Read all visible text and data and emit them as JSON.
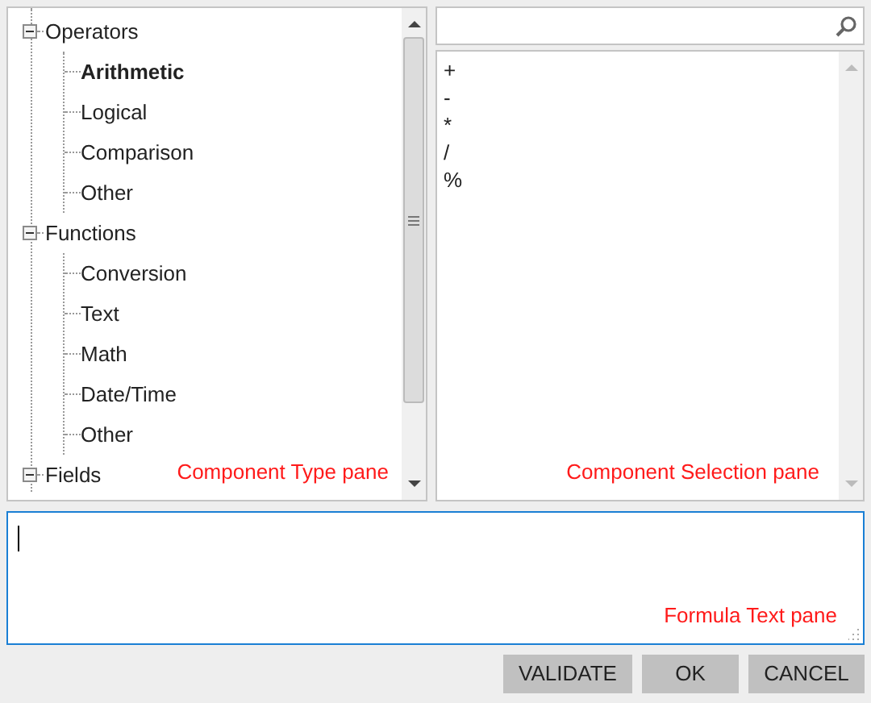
{
  "type_pane": {
    "tree": [
      {
        "label": "Operators",
        "expanded": true,
        "children": [
          {
            "label": "Arithmetic",
            "selected": true
          },
          {
            "label": "Logical",
            "selected": false
          },
          {
            "label": "Comparison",
            "selected": false
          },
          {
            "label": "Other",
            "selected": false
          }
        ]
      },
      {
        "label": "Functions",
        "expanded": true,
        "children": [
          {
            "label": "Conversion",
            "selected": false
          },
          {
            "label": "Text",
            "selected": false
          },
          {
            "label": "Math",
            "selected": false
          },
          {
            "label": "Date/Time",
            "selected": false
          },
          {
            "label": "Other",
            "selected": false
          }
        ]
      },
      {
        "label": "Fields",
        "expanded": true
      }
    ],
    "annotation": "Component Type pane"
  },
  "selection_pane": {
    "items": [
      "+",
      "-",
      "*",
      "/",
      "%"
    ],
    "annotation": "Component Selection pane"
  },
  "formula_pane": {
    "annotation": "Formula Text pane"
  },
  "buttons": [
    "VALIDATE",
    "OK",
    "CANCEL"
  ]
}
